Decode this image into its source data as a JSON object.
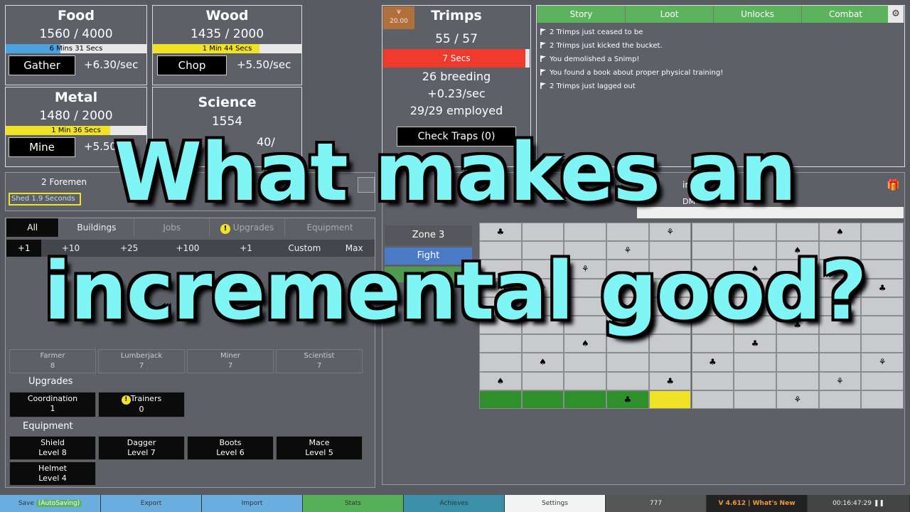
{
  "resources": {
    "food": {
      "name": "Food",
      "amount": "1560 / 4000",
      "timer": "6 Mins 31 Secs",
      "fill": 0.39,
      "color": "#4aa3df",
      "action": "Gather",
      "rate": "+6.30/sec"
    },
    "wood": {
      "name": "Wood",
      "amount": "1435 / 2000",
      "timer": "1 Min 44 Secs",
      "fill": 0.72,
      "color": "#f0e325",
      "action": "Chop",
      "rate": "+5.50/sec"
    },
    "metal": {
      "name": "Metal",
      "amount": "1480 / 2000",
      "timer": "1 Min 36 Secs",
      "fill": 0.74,
      "color": "#f0e325",
      "action": "Mine",
      "rate": "+5.50"
    },
    "science": {
      "name": "Science",
      "amount": "1554",
      "partial_text": "40/"
    }
  },
  "trimps": {
    "name": "Trimps",
    "badge_value": "20.00",
    "count": "55 / 57",
    "timer": "7 Secs",
    "fill": 0.97,
    "bar_color": "#f03a2e",
    "breeding": "26 breeding",
    "rate": "+0.23/sec",
    "employed": "29/29 employed",
    "check_traps": "Check Traps (0)"
  },
  "log": {
    "tabs": [
      "Story",
      "Loot",
      "Unlocks",
      "Combat"
    ],
    "lines": [
      "2 Trimps just ceased to be",
      "2 Trimps just kicked the bucket.",
      "You demolished a Snimp!",
      "You found a book about proper physical training!",
      "2 Trimps just lagged out"
    ]
  },
  "foremen": {
    "title": "2 Foremen",
    "queue": "Shed  1.9 Seconds"
  },
  "buy_tabs": [
    "All",
    "Buildings",
    "Jobs",
    "Upgrades",
    "Equipment"
  ],
  "buy_amounts": [
    "+1",
    "+10",
    "+25",
    "+100",
    "+1",
    "Custom",
    "Max"
  ],
  "jobs": [
    {
      "name": "Farmer",
      "count": "8"
    },
    {
      "name": "Lumberjack",
      "count": "7"
    },
    {
      "name": "Miner",
      "count": "7"
    },
    {
      "name": "Scientist",
      "count": "7"
    }
  ],
  "upgrades_title": "Upgrades",
  "upgrades": [
    {
      "name": "Coordination",
      "count": "1"
    },
    {
      "name": "Trainers",
      "count": "0"
    }
  ],
  "equipment_title": "Equipment",
  "equipment": [
    {
      "name": "Shield",
      "level": "Level  8"
    },
    {
      "name": "Dagger",
      "level": "Level  7"
    },
    {
      "name": "Boots",
      "level": "Level  6"
    },
    {
      "name": "Mace",
      "level": "Level  5"
    },
    {
      "name": "Helmet",
      "level": "Level  4"
    }
  ],
  "battle": {
    "zone": "Zone 3",
    "fight": "Fight",
    "enemy_partial": "imp",
    "dmg_partial": "DM"
  },
  "footer": [
    {
      "label": "Save",
      "extra": "(AutoSaving)",
      "color": "#6aaee0"
    },
    {
      "label": "Export",
      "color": "#6aaee0"
    },
    {
      "label": "Import",
      "color": "#6aaee0"
    },
    {
      "label": "Stats",
      "color": "#56b05a"
    },
    {
      "label": "Achieves",
      "color": "#3b8fa8"
    },
    {
      "label": "Settings",
      "color": "#f4f4f4"
    },
    {
      "label": "777",
      "color": "#555"
    },
    {
      "label": "V 4.612 | What's New",
      "color": "#222"
    },
    {
      "label": "00:16:47:29",
      "color": "#444"
    }
  ],
  "overlay": {
    "line1": "What makes an",
    "line2": "incremental good?"
  }
}
